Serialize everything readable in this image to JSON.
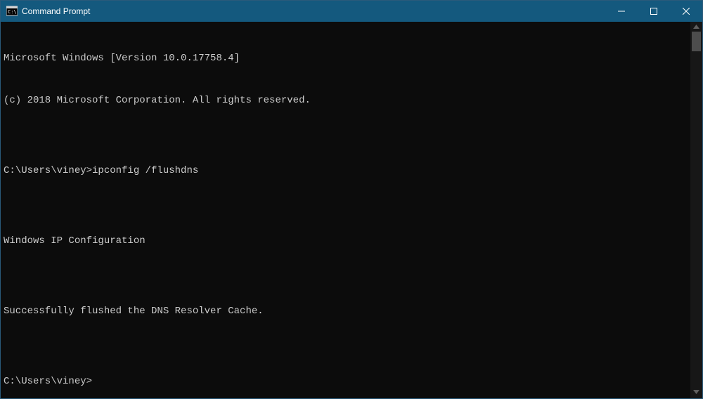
{
  "window": {
    "title": "Command Prompt"
  },
  "terminal": {
    "lines": [
      "Microsoft Windows [Version 10.0.17758.4]",
      "(c) 2018 Microsoft Corporation. All rights reserved.",
      "",
      "C:\\Users\\viney>ipconfig /flushdns",
      "",
      "Windows IP Configuration",
      "",
      "Successfully flushed the DNS Resolver Cache.",
      "",
      "C:\\Users\\viney>"
    ]
  }
}
